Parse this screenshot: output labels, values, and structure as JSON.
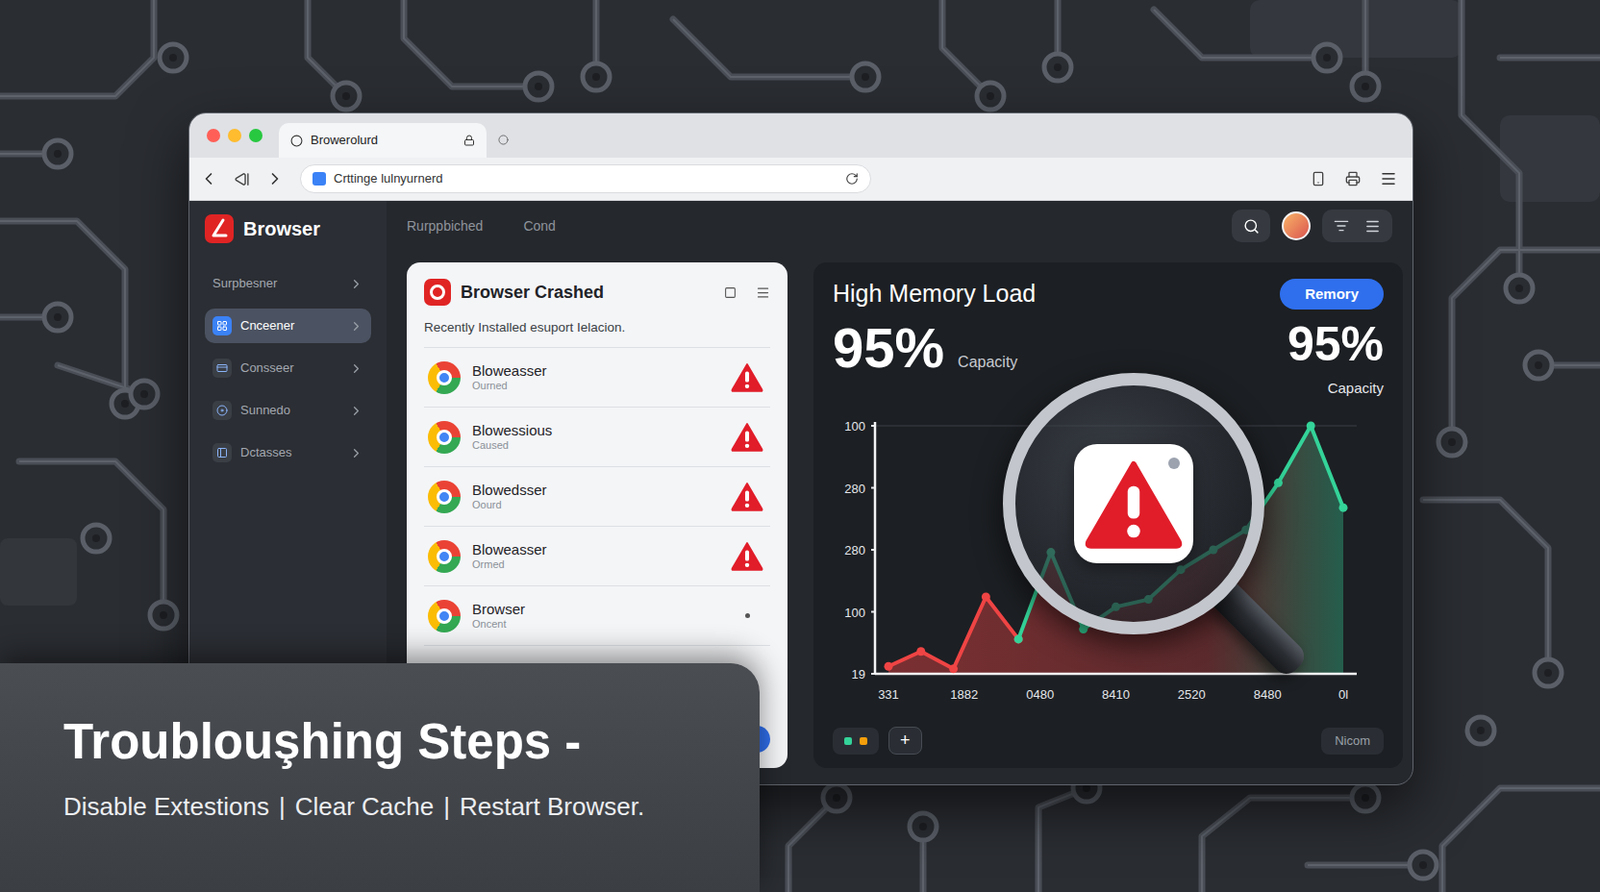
{
  "window": {
    "tab_title": "Browerolurd",
    "url": "Crttinge lulnyurnerd"
  },
  "app": {
    "name": "Browser"
  },
  "header_tabs": [
    {
      "label": "Rurppbiched",
      "selected": false
    },
    {
      "label": "Cond",
      "selected": false
    }
  ],
  "sidebar": {
    "items": [
      {
        "label": "Surpbesner",
        "kind": "heading",
        "selected": false
      },
      {
        "label": "Cnceener",
        "kind": "item",
        "selected": true
      },
      {
        "label": "Consseer",
        "kind": "item",
        "selected": false
      },
      {
        "label": "Sunnedo",
        "kind": "item",
        "selected": false
      },
      {
        "label": "Dctasses",
        "kind": "item",
        "selected": false
      }
    ]
  },
  "crash_card": {
    "title": "Browser Crashed",
    "subtitle": "Recently Installed esuport Ielacion.",
    "rows": [
      {
        "name": "Bloweasser",
        "status": "Ourned",
        "warning": true
      },
      {
        "name": "Blowessious",
        "status": "Caused",
        "warning": true
      },
      {
        "name": "Blowedsser",
        "status": "Oourd",
        "warning": true
      },
      {
        "name": "Bloweasser",
        "status": "Ormed",
        "warning": true
      },
      {
        "name": "Browser",
        "status": "Oncent",
        "warning": false
      }
    ]
  },
  "memory": {
    "title": "High Memory Load",
    "button": "Remory",
    "value": "95%",
    "unit": "Capacity",
    "value_right": "95%",
    "unit_right": "Capacity"
  },
  "chart": {
    "y_ticks": [
      "100",
      "280",
      "280",
      "100",
      "19"
    ],
    "x_ticks": [
      "331",
      "1882",
      "0480",
      "8410",
      "2520",
      "8480",
      "0l"
    ],
    "series": [
      {
        "color": "#ef4444",
        "values": [
          3,
          9,
          2,
          31,
          14
        ]
      },
      {
        "color": "#34d399",
        "values": [
          14,
          49,
          18,
          27,
          30,
          42,
          50,
          58,
          77,
          100,
          67
        ]
      }
    ]
  },
  "chart_controls": {
    "add": "+",
    "label": "Nicom"
  },
  "overlay": {
    "title": "Troublouşhing Steps -",
    "separator": "|",
    "steps": [
      "Disable Extestions",
      "Clear Cache",
      "Restart Browser."
    ]
  }
}
